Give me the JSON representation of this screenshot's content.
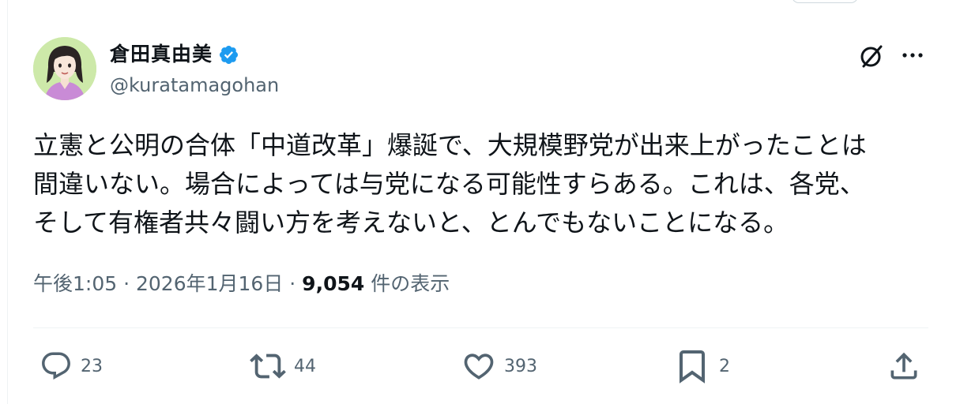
{
  "author": {
    "display_name": "倉田真由美",
    "handle": "@kuratamagohan",
    "verified": true,
    "avatar": "avatar-illustration"
  },
  "header_icons": {
    "grok": "grok-icon",
    "more": "more-icon"
  },
  "tweet": {
    "text": "立憲と公明の合体「中道改革」爆誕で、大規模野党が出来上がったことは\n間違いない。場合によっては与党になる可能性すらある。これは、各党、\nそして有権者共々闘い方を考えないと、とんでもないことになる。"
  },
  "meta": {
    "time": "午後1:05",
    "separator1": " · ",
    "date": "2026年1月16日",
    "separator2": " · ",
    "views_count": "9,054",
    "views_label": " 件の表示"
  },
  "actions": {
    "reply": {
      "icon": "reply-icon",
      "count": "23"
    },
    "repost": {
      "icon": "repost-icon",
      "count": "44"
    },
    "like": {
      "icon": "heart-icon",
      "count": "393"
    },
    "bookmark": {
      "icon": "bookmark-icon",
      "count": "2"
    },
    "share": {
      "icon": "share-icon"
    }
  },
  "colors": {
    "text_primary": "#0f1419",
    "text_secondary": "#536471",
    "verified_blue": "#1d9bf0",
    "divider": "#eff3f4",
    "avatar_bg": "#cde9a9"
  }
}
